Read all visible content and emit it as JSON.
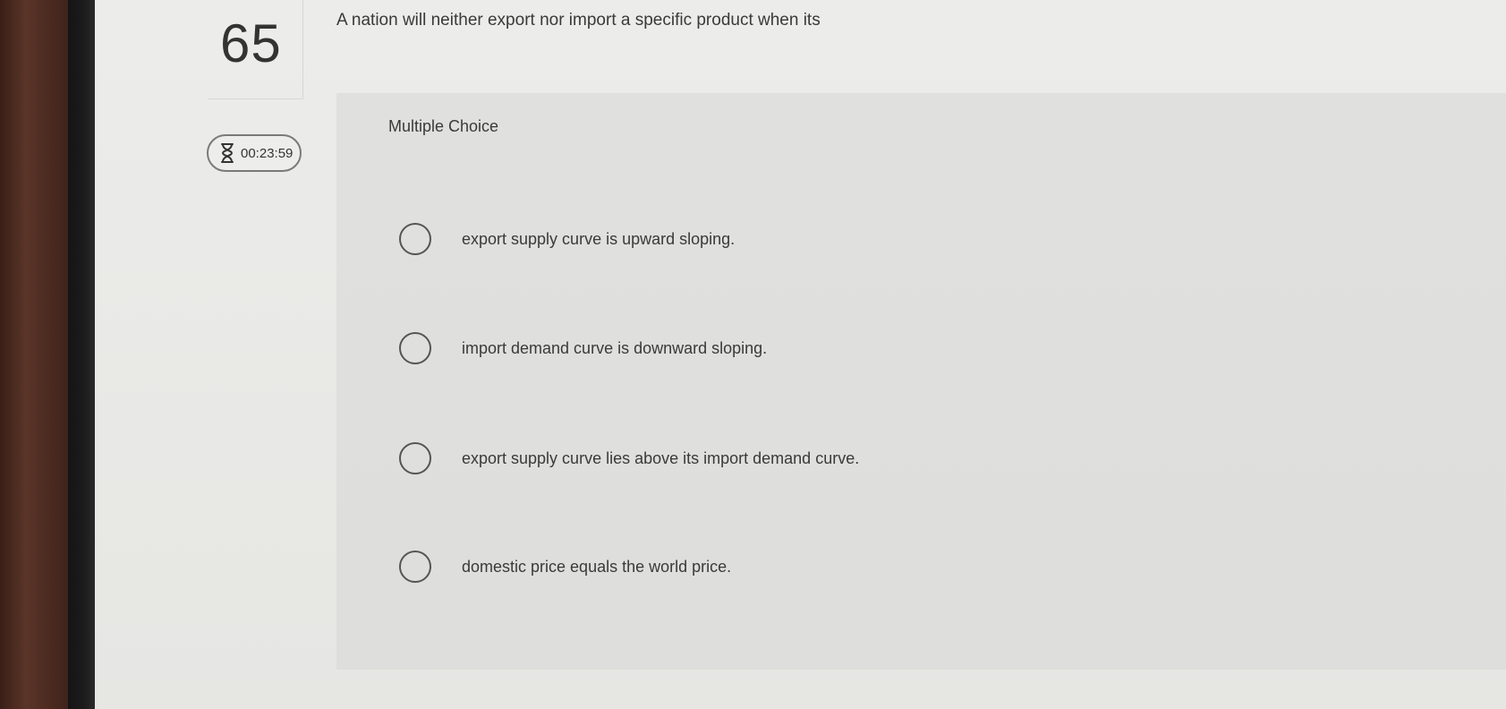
{
  "question": {
    "number": "65",
    "text": "A nation will neither export nor import a specific product when its"
  },
  "timer": {
    "icon": "hourglass-icon",
    "value": "00:23:59"
  },
  "section_label": "Multiple Choice",
  "options": [
    {
      "label": "export supply curve is upward sloping."
    },
    {
      "label": "import demand curve is downward sloping."
    },
    {
      "label": "export supply curve lies above its import demand curve."
    },
    {
      "label": "domestic price equals the world price."
    }
  ]
}
